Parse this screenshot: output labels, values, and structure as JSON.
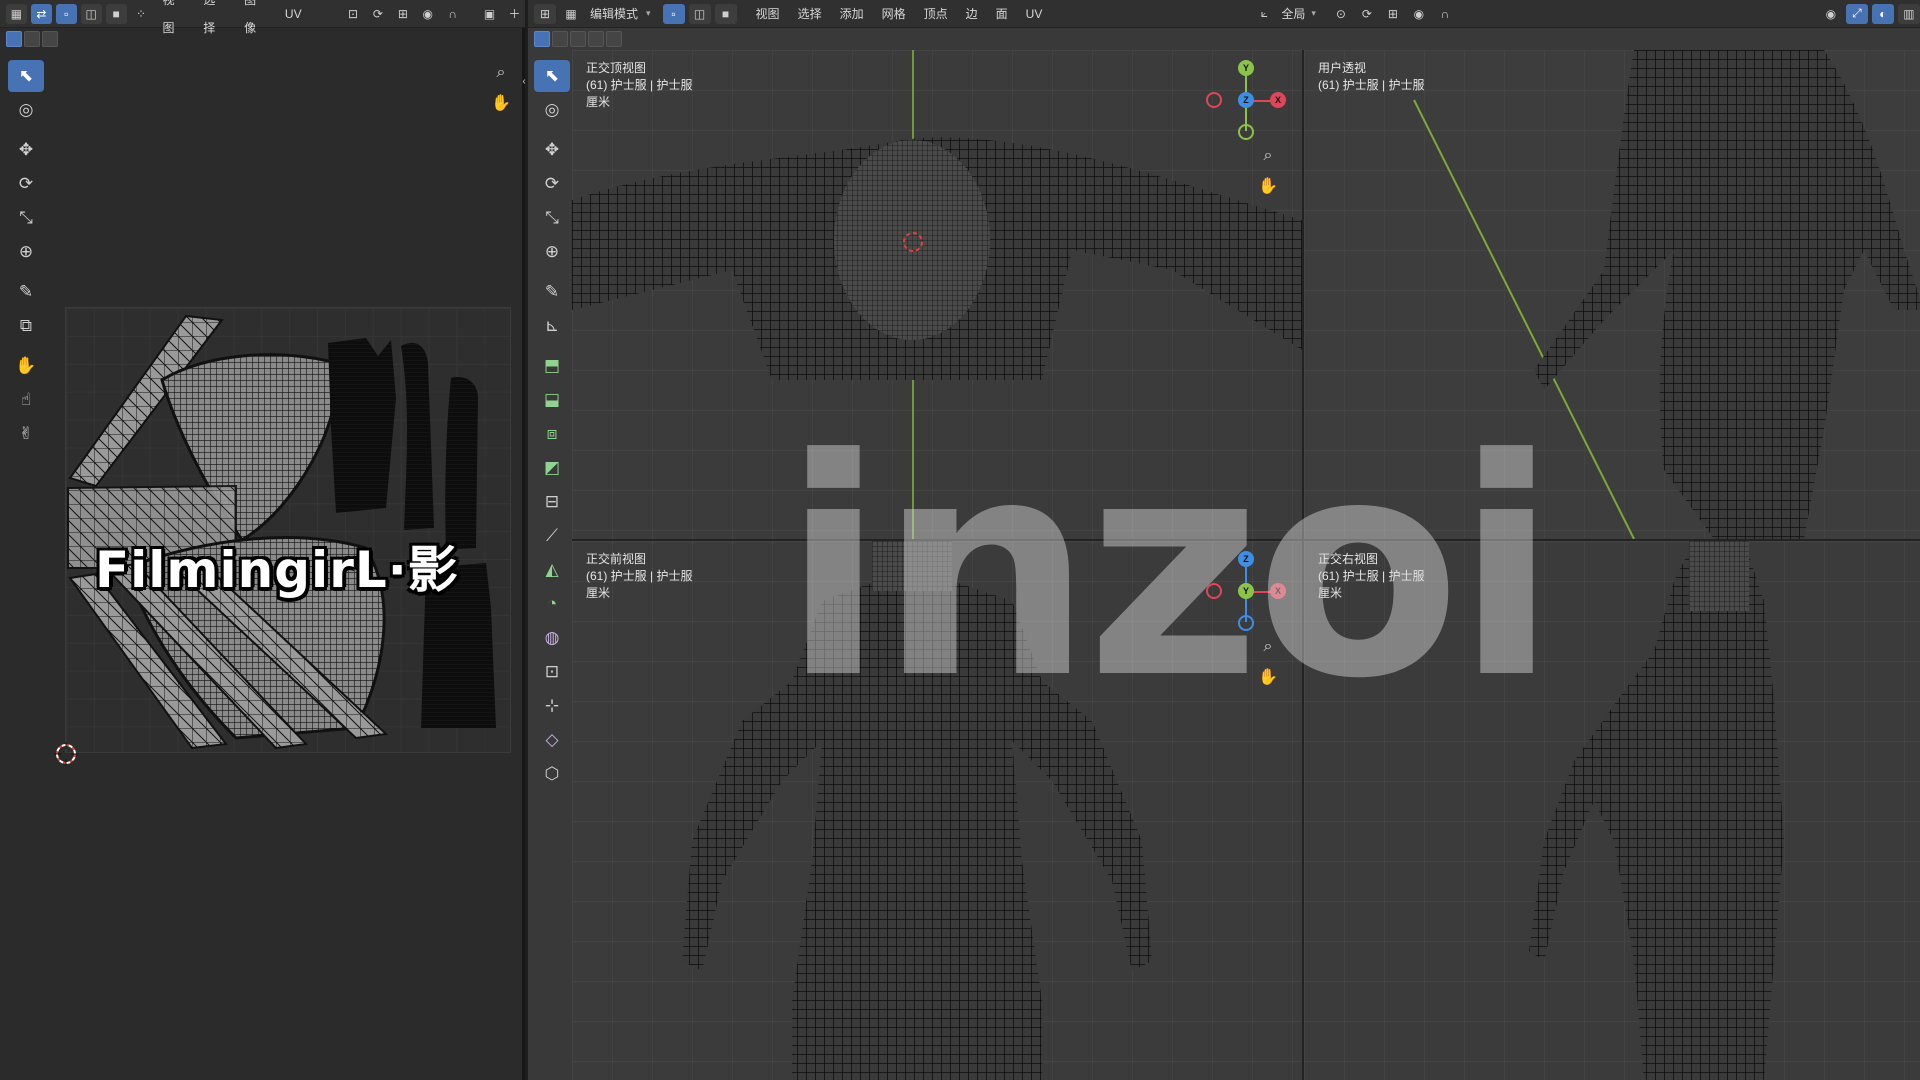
{
  "uv_editor": {
    "menu": [
      "视图",
      "选择",
      "图像",
      "UV"
    ],
    "tools": [
      "select-box",
      "cursor",
      "move",
      "rotate",
      "scale",
      "transform",
      "annotate",
      "rip-region",
      "grab",
      "relax",
      "pinch"
    ],
    "watermark": "FilmingirL·影"
  },
  "viewport": {
    "mode": "编辑模式",
    "menu": [
      "视图",
      "选择",
      "添加",
      "网格",
      "顶点",
      "边",
      "面",
      "UV"
    ],
    "transform_orientation": "全局",
    "tools": [
      "select-box",
      "cursor",
      "move",
      "rotate",
      "scale",
      "transform",
      "annotate",
      "measure",
      "add-cube",
      "extrude-region",
      "inset-faces",
      "bevel",
      "loop-cut",
      "knife",
      "poly-build",
      "spin",
      "smooth",
      "edge-slide",
      "shrink-fatten",
      "shear",
      "to-sphere"
    ],
    "quad_views": [
      {
        "title": "正交顶视图",
        "object": "(61) 护士服 | 护士服",
        "units": "厘米"
      },
      {
        "title": "用户透视",
        "object": "(61) 护士服 | 护士服",
        "units": ""
      },
      {
        "title": "正交前视图",
        "object": "(61) 护士服 | 护士服",
        "units": "厘米"
      },
      {
        "title": "正交右视图",
        "object": "(61) 护士服 | 护士服",
        "units": "厘米"
      }
    ],
    "gizmo_top": {
      "up": "Y",
      "center": "Z",
      "right": "X"
    },
    "gizmo_front": {
      "up": "Z",
      "center": "Y",
      "right": "X"
    },
    "logo": "inzoi"
  },
  "colors": {
    "accent": "#4772b3",
    "axis_x": "#e0455a",
    "axis_y": "#8bc34a",
    "axis_z": "#3f8ee6"
  }
}
